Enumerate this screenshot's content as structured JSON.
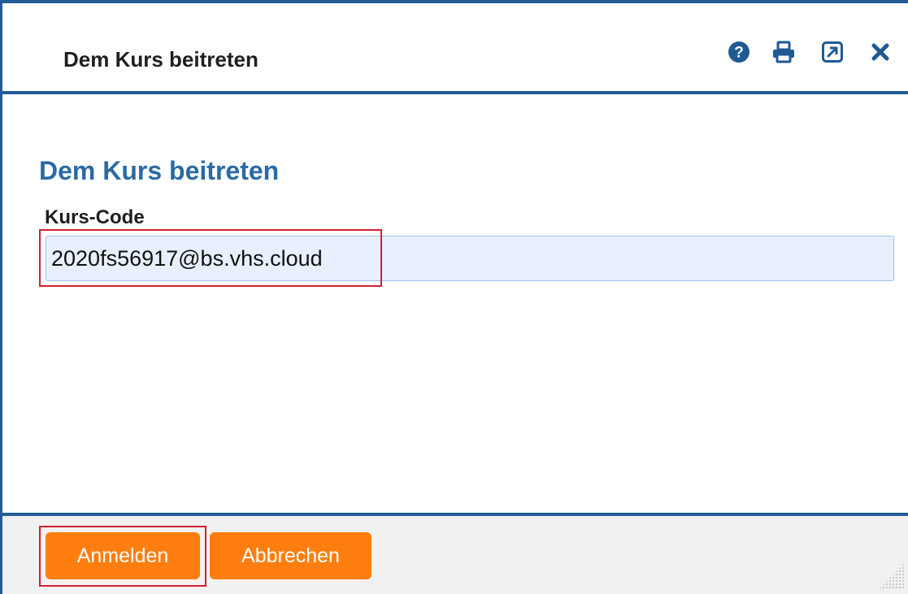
{
  "dialog": {
    "title": "Dem Kurs beitreten",
    "toolbar_icons": [
      "help-icon",
      "print-icon",
      "external-window-icon",
      "close-icon"
    ]
  },
  "form": {
    "heading": "Dem Kurs beitreten",
    "code_label": "Kurs-Code",
    "code_value": "2020fs56917@bs.vhs.cloud"
  },
  "footer": {
    "submit_label": "Anmelden",
    "cancel_label": "Abbrechen"
  },
  "colors": {
    "frame": "#215d97",
    "heading": "#2b6aa3",
    "button": "#ff7e0f",
    "input_bg": "#e8f0fe",
    "highlight": "#d32030"
  }
}
